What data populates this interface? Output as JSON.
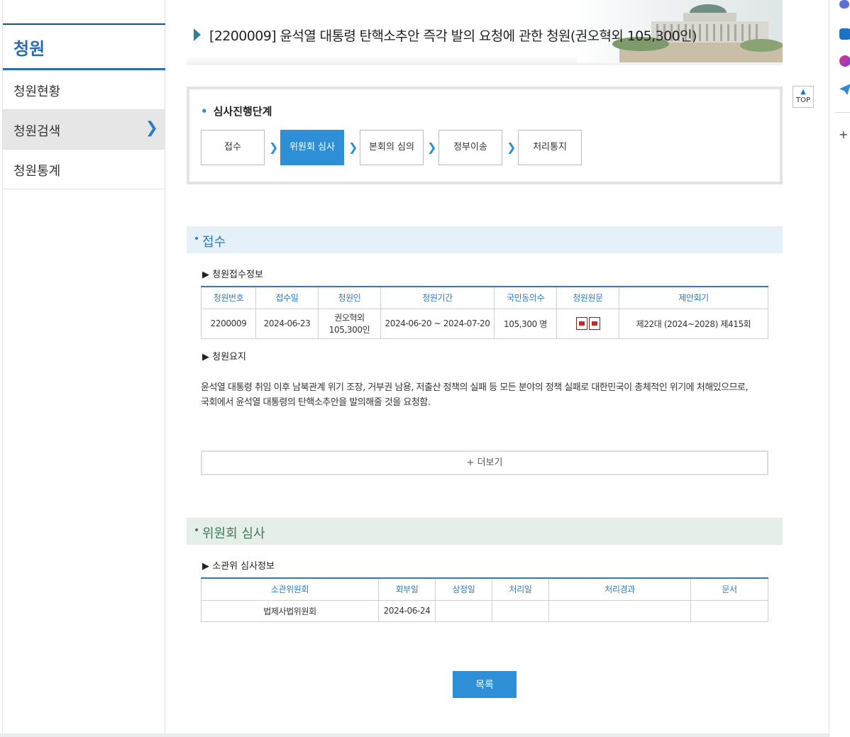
{
  "sidebar": {
    "title": "청원",
    "items": [
      {
        "label": "청원현황"
      },
      {
        "label": "청원검색"
      },
      {
        "label": "청원통계"
      }
    ]
  },
  "page": {
    "title": "[2200009] 윤석열 대통령 탄핵소추안 즉각 발의 요청에 관한 청원(권오혁외 105,300인)"
  },
  "stages": {
    "label": "심사진행단계",
    "steps": [
      "접수",
      "위원회 심사",
      "본회의 심의",
      "정부이송",
      "처리통지"
    ],
    "current": "위원회 심사"
  },
  "reception": {
    "heading": "접수",
    "info_label": "▶ 청원접수정보",
    "columns": [
      "청원번호",
      "접수일",
      "청원인",
      "청원기간",
      "국민동의수",
      "청원원문",
      "제안회기"
    ],
    "row": {
      "number": "2200009",
      "date": "2024-06-23",
      "petitioner_line1": "권오혁외",
      "petitioner_line2": "105,300인",
      "period": "2024-06-20 ~ 2024-07-20",
      "consents": "105,300 명",
      "session": "제22대 (2024~2028) 제415회"
    },
    "summary_label": "▶ 청원요지",
    "summary_line1": "윤석열 대통령 취임 이후 남북관계 위기 조장, 거부권 남용, 저출산 정책의 실패 등 모든 분야의 정책 실패로 대한민국이 총체적인 위기에 처해있으므로,",
    "summary_line2": "국회에서 윤석열 대통령의 탄핵소추안을 발의해줄 것을 요청함.",
    "more_button": "+ 더보기"
  },
  "committee": {
    "heading": "위원회 심사",
    "info_label": "▶ 소관위 심사정보",
    "columns": [
      "소관위원회",
      "회부일",
      "상정일",
      "처리일",
      "처리경과",
      "문서"
    ],
    "row": {
      "committee": "법제사법위원회",
      "referred": "2024-06-24",
      "presented": "",
      "processed": "",
      "result": "",
      "docs": ""
    }
  },
  "buttons": {
    "list": "목록",
    "top": "TOP"
  },
  "colors": {
    "accent": "#2f8fd6",
    "section_blue_bg": "#e5f0f9",
    "section_green_bg": "#e6eee9"
  }
}
